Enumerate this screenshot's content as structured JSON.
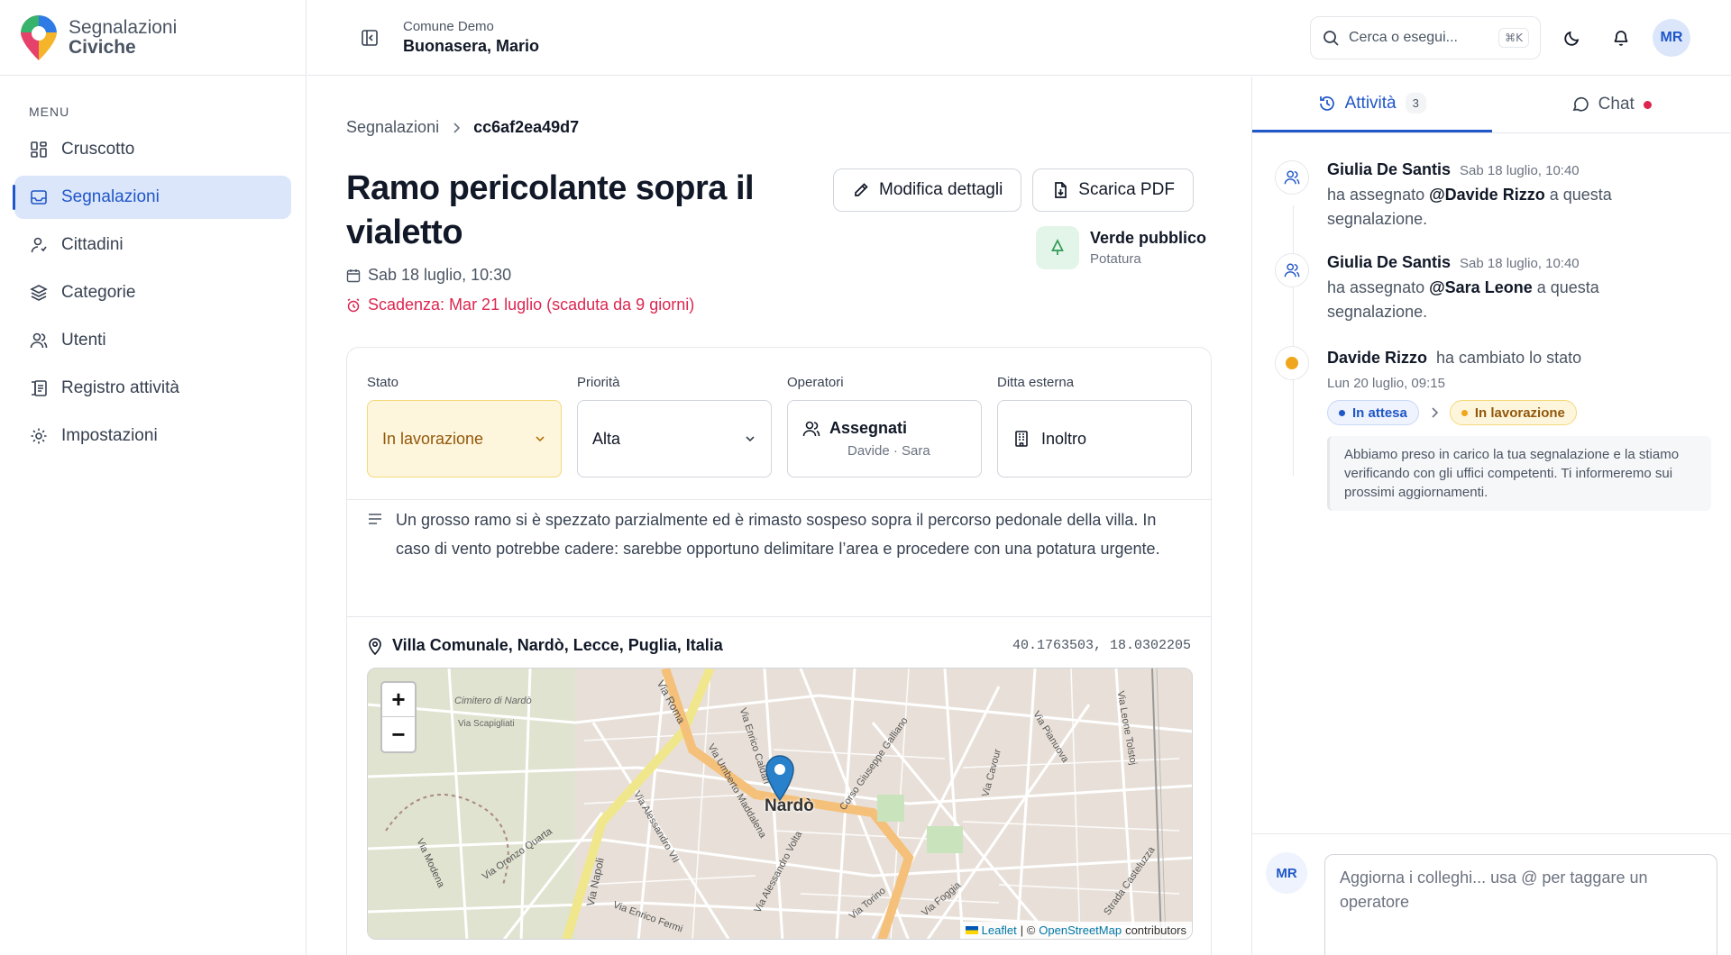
{
  "brand": {
    "line1": "Segnalazioni",
    "line2": "Civiche"
  },
  "sidebar": {
    "menu_title": "MENU",
    "items": [
      {
        "label": "Cruscotto",
        "icon": "dashboard-icon"
      },
      {
        "label": "Segnalazioni",
        "icon": "inbox-icon",
        "active": true
      },
      {
        "label": "Cittadini",
        "icon": "user-icon"
      },
      {
        "label": "Categorie",
        "icon": "layers-icon"
      },
      {
        "label": "Utenti",
        "icon": "users-icon"
      },
      {
        "label": "Registro attività",
        "icon": "log-icon"
      },
      {
        "label": "Impostazioni",
        "icon": "gear-icon"
      }
    ]
  },
  "header": {
    "org": "Comune Demo",
    "user": "Buonasera, Mario",
    "search_placeholder": "Cerca o esegui...",
    "shortcut": "⌘K",
    "avatar": "MR"
  },
  "breadcrumb": {
    "parent": "Segnalazioni",
    "current": "cc6af2ea49d7"
  },
  "report": {
    "title": "Ramo pericolante sopra il vialetto",
    "date": "Sab 18 luglio, 10:30",
    "deadline": "Scadenza: Mar 21 luglio (scaduta da 9 giorni)",
    "edit_label": "Modifica dettagli",
    "pdf_label": "Scarica PDF",
    "category": "Verde pubblico",
    "subcategory": "Potatura"
  },
  "fields": {
    "status_label": "Stato",
    "status_value": "In lavorazione",
    "priority_label": "Priorità",
    "priority_value": "Alta",
    "operators_label": "Operatori",
    "operators_value": "Assegnati",
    "operators_names": "Davide · Sara",
    "company_label": "Ditta esterna",
    "company_value": "Inoltro"
  },
  "description": "Un grosso ramo si è spezzato parzialmente ed è rimasto sospeso sopra il percorso pedonale della villa. In caso di vento potrebbe cadere: sarebbe opportuno delimitare l’area e procedere con una potatura urgente.",
  "location": {
    "address": "Villa Comunale, Nardò, Lecce, Puglia, Italia",
    "coords": "40.1763503, 18.0302205"
  },
  "map": {
    "zoom_in": "+",
    "zoom_out": "−",
    "place_label": "Nardò",
    "streets": [
      "Via Roma",
      "Via Napoli",
      "Via Leone Tolstoj",
      "Via Pianuova",
      "Corso Giuseppe Galliano",
      "Via Alessandro Volta",
      "Via Umberto Maddalena",
      "Via Enrico Caldari",
      "Via Modena",
      "Via Scapigliati",
      "Cimitero di Nardò",
      "Via Alessandro VII",
      "Via Oronzo Quarta",
      "Via Foggia",
      "Via Torino",
      "Strada Casteluzza",
      "Via Cavour",
      "Via Enrico Fermi"
    ],
    "attr_leaflet": "Leaflet",
    "attr_sep": "| ©",
    "attr_osm": "OpenStreetMap",
    "attr_tail": "contributors"
  },
  "panel": {
    "tab_activity": "Attività",
    "tab_activity_count": "3",
    "tab_chat": "Chat",
    "events": [
      {
        "author": "Giulia De Santis",
        "time": "Sab 18 luglio, 10:40",
        "pre": "ha assegnato",
        "mention": "@Davide Rizzo",
        "post": "a questa segnalazione."
      },
      {
        "author": "Giulia De Santis",
        "time": "Sab 18 luglio, 10:40",
        "pre": "ha assegnato",
        "mention": "@Sara Leone",
        "post": "a questa segnalazione."
      },
      {
        "author": "Davide Rizzo",
        "action": "ha cambiato lo stato",
        "time": "Lun 20 luglio, 09:15",
        "from": "In attesa",
        "to": "In lavorazione",
        "note": "Abbiamo preso in carico la tua segnalazione e la stiamo verificando con gli uffici competenti. Ti informeremo sui prossimi aggiornamenti."
      }
    ],
    "composer_avatar": "MR",
    "composer_placeholder": "Aggiorna i colleghi... usa @ per taggare un operatore"
  },
  "colors": {
    "accent": "#1f56c8",
    "danger": "#dc2650",
    "amber": "#92580b",
    "green": "#2e9b55"
  }
}
